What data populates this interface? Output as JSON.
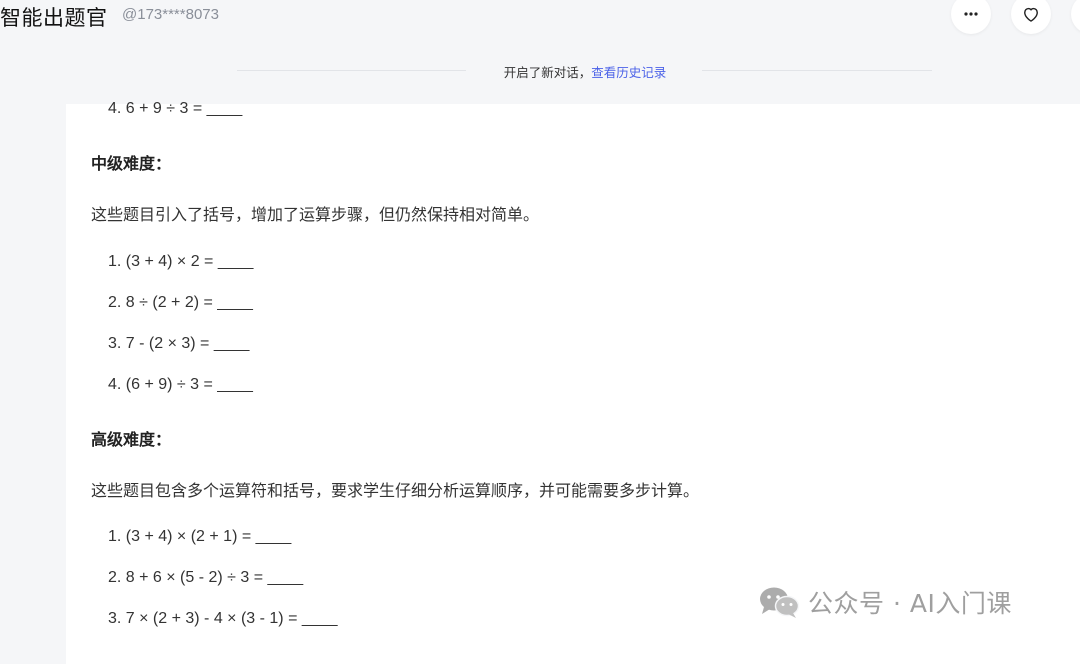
{
  "header": {
    "bot_name": "智能出题官",
    "user": "@173****8073",
    "more_icon": "more-horizontal-icon",
    "favorite_icon": "heart-icon"
  },
  "history_notice": {
    "text": "开启了新对话，",
    "link": "查看历史记录"
  },
  "message": {
    "prev_item": "4. 6 + 9 ÷ 3 = ____",
    "intermediate": {
      "heading": "中级难度：",
      "desc": "这些题目引入了括号，增加了运算步骤，但仍然保持相对简单。",
      "items": [
        "1. (3 + 4) × 2 = ____",
        "2. 8 ÷ (2 + 2) = ____",
        "3. 7 - (2 × 3) = ____",
        "4. (6 + 9) ÷ 3 = ____"
      ]
    },
    "advanced": {
      "heading": "高级难度：",
      "desc": "这些题目包含多个运算符和括号，要求学生仔细分析运算顺序，并可能需要多步计算。",
      "items": [
        "1. (3 + 4) × (2 + 1) = ____",
        "2. 8 + 6 × (5 - 2) ÷ 3 = ____",
        "3. 7 × (2 + 3) - 4 × (3 - 1) = ____"
      ]
    }
  },
  "watermark": {
    "text": "公众号 · AI入门课",
    "icon": "wechat-icon"
  }
}
